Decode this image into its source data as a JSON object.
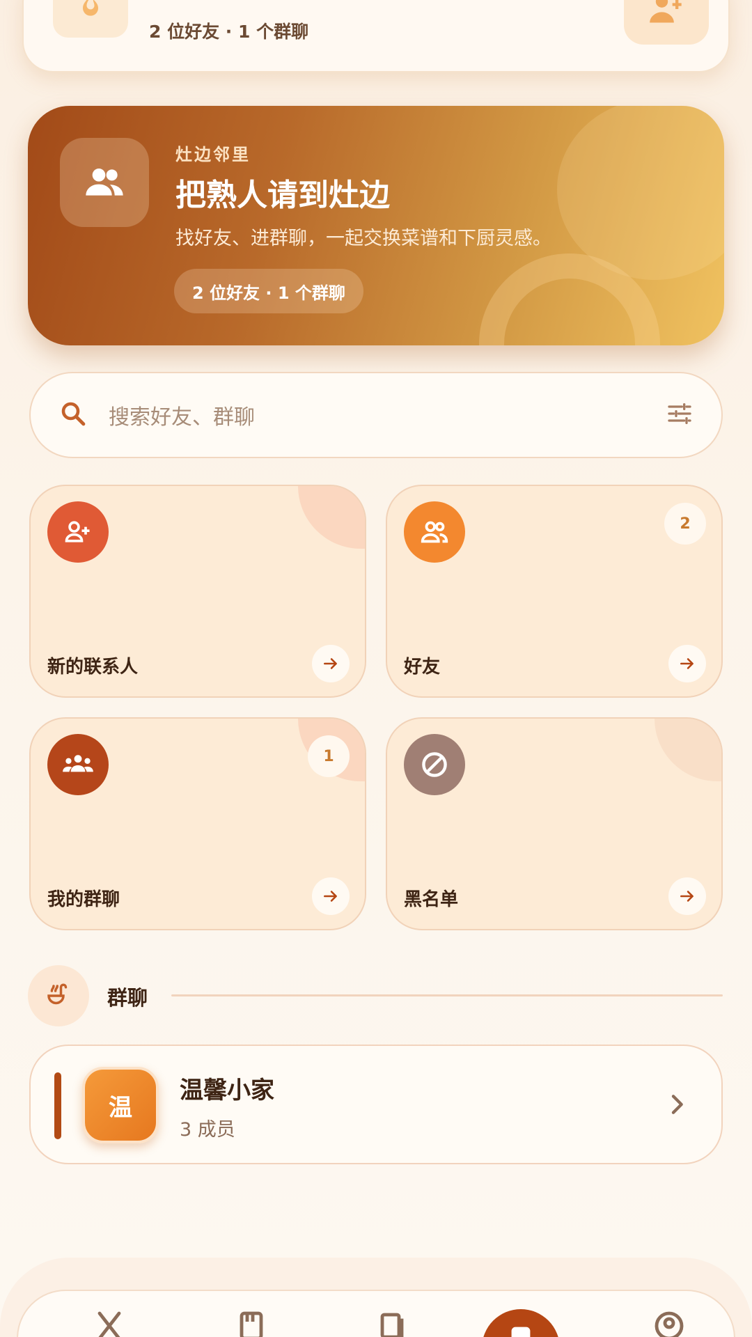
{
  "top_card": {
    "subtitle": "2 位好友 · 1 个群聊"
  },
  "hero": {
    "eyebrow": "灶边邻里",
    "title": "把熟人请到灶边",
    "description": "找好友、进群聊，一起交换菜谱和下厨灵感。",
    "pill": "2 位好友 · 1 个群聊"
  },
  "search": {
    "placeholder": "搜索好友、群聊"
  },
  "grid": [
    {
      "label": "新的联系人",
      "badge": "",
      "icon": "person-add-icon",
      "color": "#E05A35"
    },
    {
      "label": "好友",
      "badge": "2",
      "icon": "people-icon",
      "color": "#F3882F"
    },
    {
      "label": "我的群聊",
      "badge": "1",
      "icon": "groups-icon",
      "color": "#B5461A"
    },
    {
      "label": "黑名单",
      "badge": "",
      "icon": "block-icon",
      "color": "#A07F74"
    }
  ],
  "section": {
    "title": "群聊",
    "icon": "ladle-icon"
  },
  "groups": [
    {
      "avatar_char": "温",
      "name": "温馨小家",
      "members": "3 成员"
    }
  ],
  "colors": {
    "accent": "#B54613",
    "card_bg": "#FDEBD6",
    "text_dark": "#3E2414"
  }
}
